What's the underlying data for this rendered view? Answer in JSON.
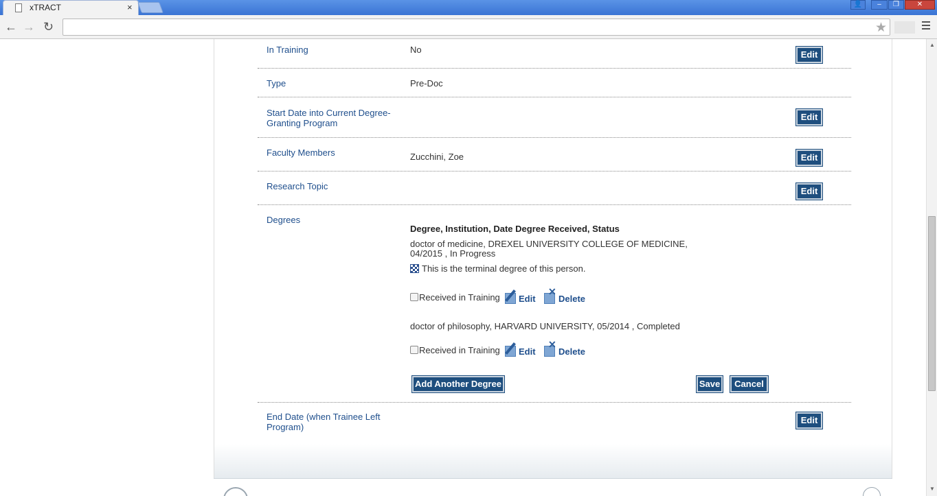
{
  "browser": {
    "tab_title": "xTRACT",
    "tab_close": "×",
    "address": "",
    "window_controls": [
      "👤",
      "–",
      "❐",
      "✕"
    ]
  },
  "rows": [
    {
      "label": "In Training",
      "value": "No",
      "edit": "Edit"
    },
    {
      "label": "Type",
      "value": "Pre-Doc"
    },
    {
      "label": "Start Date into Current Degree-Granting Program",
      "value": "",
      "edit": "Edit"
    },
    {
      "label": "Faculty Members",
      "value": "Zucchini, Zoe",
      "edit": "Edit"
    },
    {
      "label": "Research Topic",
      "value": "",
      "edit": "Edit"
    },
    {
      "label": "Degrees"
    },
    {
      "label": "End Date (when Trainee Left Program)",
      "value": "",
      "edit": "Edit"
    }
  ],
  "degrees": {
    "header": "Degree, Institution, Date Degree Received, Status",
    "items": [
      {
        "line1": "doctor of medicine, DREXEL UNIVERSITY COLLEGE OF MEDICINE,",
        "line2": "04/2015 , In Progress",
        "terminal_note": "This is the terminal degree of this person.",
        "received_label": "Received in Training",
        "received_checked": false,
        "edit": "Edit",
        "delete": "Delete"
      },
      {
        "line1": "doctor of philosophy, HARVARD UNIVERSITY, 05/2014 , Completed",
        "received_label": "Received in Training",
        "received_checked": false,
        "edit": "Edit",
        "delete": "Delete"
      }
    ],
    "add_button": "Add Another Degree",
    "save_button": "Save",
    "cancel_button": "Cancel"
  }
}
